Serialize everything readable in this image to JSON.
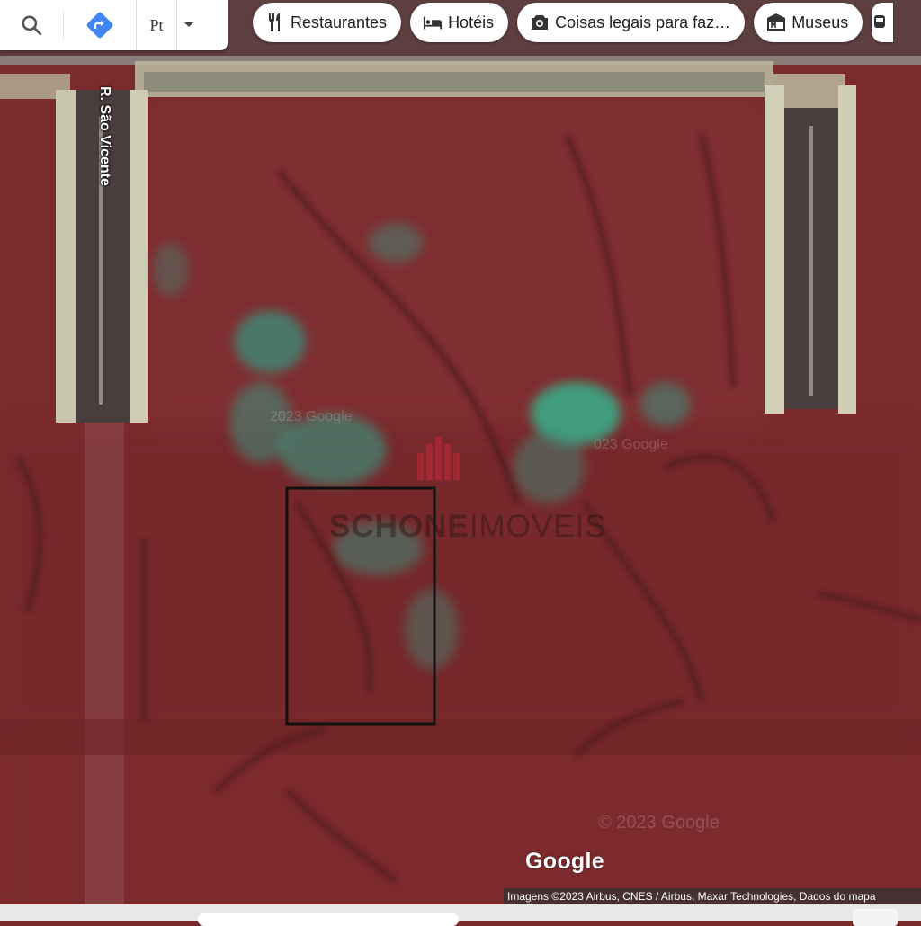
{
  "toolbar": {
    "language_label": "Pt"
  },
  "chips": [
    {
      "label": "Restaurantes",
      "icon": "fork-knife-icon"
    },
    {
      "label": "Hotéis",
      "icon": "bed-icon"
    },
    {
      "label": "Coisas legais para faz…",
      "icon": "camera-icon"
    },
    {
      "label": "Museus",
      "icon": "museum-icon"
    }
  ],
  "map": {
    "street_label": "R. São Vicente",
    "watermark_brand": "SCHONE",
    "watermark_suffix": "IMOVEIS",
    "faint_text_1": "2023 Google",
    "faint_text_2": "023 Google",
    "faint_text_3": "© 2023 Google"
  },
  "footer": {
    "logo": "Google",
    "attribution": "Imagens ©2023 Airbus, CNES / Airbus, Maxar Technologies, Dados do mapa"
  },
  "colors": {
    "terrain": "#7a2a2c",
    "accent_blue": "#4285f4"
  }
}
